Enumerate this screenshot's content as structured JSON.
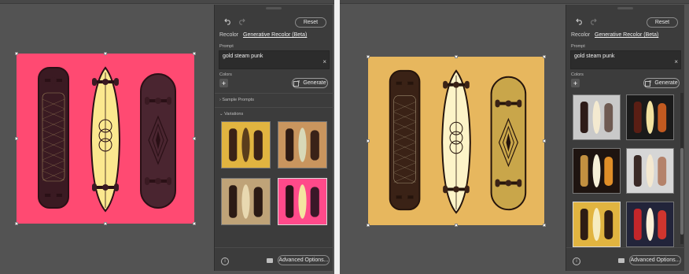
{
  "toolbar": {
    "undo": "undo-icon",
    "redo": "redo-icon",
    "reset_label": "Reset"
  },
  "tabs": [
    {
      "label": "Recolor"
    },
    {
      "label": "Generative Recolor (Beta)"
    }
  ],
  "prompt": {
    "label": "Prompt",
    "value": "gold steam punk",
    "clear": "×"
  },
  "colors": {
    "label": "Colors",
    "add": "+"
  },
  "generate_label": "Generate",
  "sample_prompts_label": "Sample Prompts",
  "variations_label": "Variations",
  "footer": {
    "advanced_label": "Advanced Options..."
  },
  "left_artboard": {
    "background": "#ff4a72",
    "board_dark": "#3a1a22",
    "board_mid": "#4a2530",
    "board_light": "#fbe88f",
    "line": "#2a1016"
  },
  "right_artboard": {
    "background": "#e7b75e",
    "board_dark": "#3a2216",
    "board_light": "#fdf4c8",
    "board_gold": "#c9a64a",
    "line": "#25140c"
  },
  "left_variations": [
    {
      "bg": "#e1b440",
      "a": "#3b2217",
      "b": "#5a3d1c",
      "c": "#3b2217"
    },
    {
      "bg": "#c9955e",
      "a": "#2e1b14",
      "b": "#d8d8b8",
      "c": "#3a2218"
    },
    {
      "bg": "#bfa378",
      "a": "#2b1a14",
      "b": "#e8d8b0",
      "c": "#2b1a14"
    },
    {
      "bg": "#ff4a8a",
      "a": "#2a1218",
      "b": "#f4e5a0",
      "c": "#3a1828"
    }
  ],
  "right_variations": [
    {
      "bg": "#c9c9c9",
      "a": "#2e1c18",
      "b": "#f4ead0",
      "c": "#6e5a52"
    },
    {
      "bg": "#1a1a1a",
      "a": "#5a1e14",
      "b": "#f2e2a0",
      "c": "#c25a20"
    },
    {
      "bg": "#1e1410",
      "a": "#c29040",
      "b": "#f6f0d8",
      "c": "#e08e28"
    },
    {
      "bg": "#d6d6d6",
      "a": "#3a2a26",
      "b": "#f4e8d0",
      "c": "#b4826a"
    },
    {
      "bg": "#e1b440",
      "a": "#2e1c14",
      "b": "#f6ecc0",
      "c": "#2e1c14"
    },
    {
      "bg": "#22243a",
      "a": "#c4262a",
      "b": "#fbf0d8",
      "c": "#d0352e"
    }
  ]
}
